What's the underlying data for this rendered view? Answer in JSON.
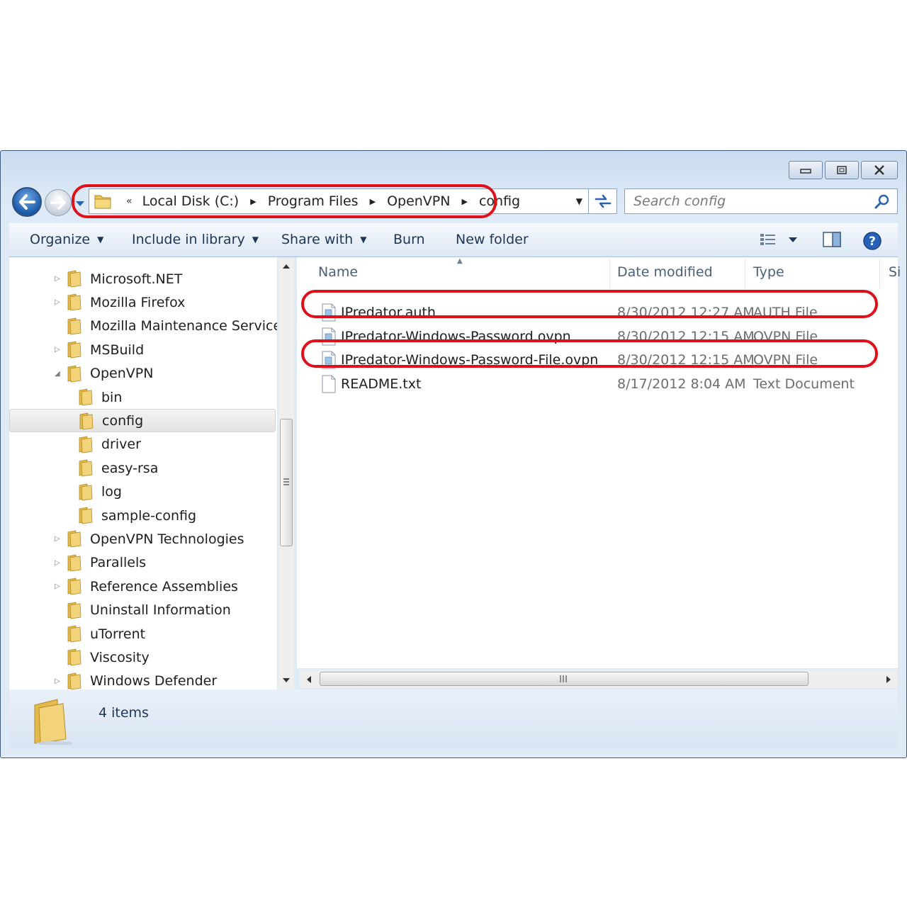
{
  "address_bar": {
    "overflow": "«",
    "crumbs": [
      "Local Disk (C:)",
      "Program Files",
      "OpenVPN",
      "config"
    ]
  },
  "search": {
    "placeholder": "Search config"
  },
  "toolbar": {
    "organize": "Organize",
    "include_in_library": "Include in library",
    "share_with": "Share with",
    "burn": "Burn",
    "new_folder": "New folder"
  },
  "nav_tree": [
    {
      "label": "Microsoft.NET",
      "expandable": true
    },
    {
      "label": "Mozilla Firefox",
      "expandable": true
    },
    {
      "label": "Mozilla Maintenance Service",
      "expandable": false
    },
    {
      "label": "MSBuild",
      "expandable": true
    },
    {
      "label": "OpenVPN",
      "expanded": true
    },
    {
      "label": "bin"
    },
    {
      "label": "config",
      "selected": true
    },
    {
      "label": "driver"
    },
    {
      "label": "easy-rsa"
    },
    {
      "label": "log"
    },
    {
      "label": "sample-config"
    },
    {
      "label": "OpenVPN Technologies",
      "expandable": true
    },
    {
      "label": "Parallels",
      "expandable": true
    },
    {
      "label": "Reference Assemblies",
      "expandable": true
    },
    {
      "label": "Uninstall Information",
      "expandable": false
    },
    {
      "label": "uTorrent",
      "expandable": false
    },
    {
      "label": "Viscosity",
      "expandable": false
    },
    {
      "label": "Windows Defender",
      "expandable": true
    }
  ],
  "columns": {
    "name": "Name",
    "date_modified": "Date modified",
    "type": "Type",
    "size": "Si"
  },
  "files": [
    {
      "name": "IPredator.auth",
      "date": "8/30/2012 12:27 AM",
      "type": "AUTH File",
      "highlighted": true
    },
    {
      "name": "IPredator-Windows-Password.ovpn",
      "date": "8/30/2012 12:15 AM",
      "type": "OVPN File",
      "highlighted": false
    },
    {
      "name": "IPredator-Windows-Password-File.ovpn",
      "date": "8/30/2012 12:15 AM",
      "type": "OVPN File",
      "highlighted": true
    },
    {
      "name": "README.txt",
      "date": "8/17/2012 8:04 AM",
      "type": "Text Document",
      "highlighted": false
    }
  ],
  "status": {
    "item_count": "4 items"
  },
  "colors": {
    "annotation_red": "#e0101a",
    "toolbar_text": "#1e3656",
    "folder_yellow": "#e8c45a"
  }
}
